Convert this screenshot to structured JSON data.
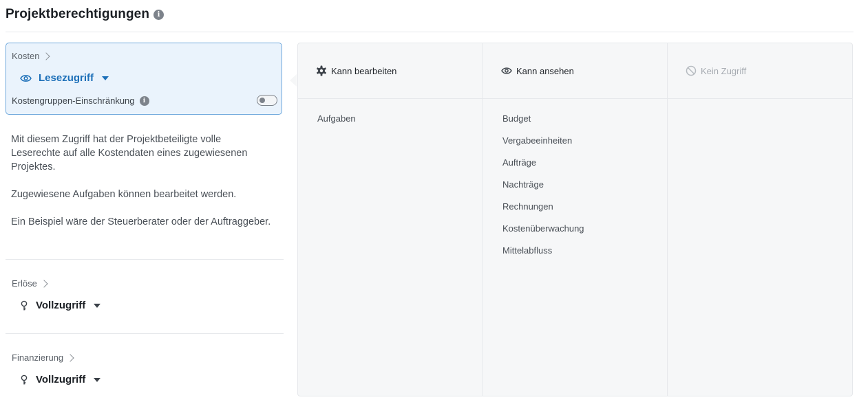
{
  "page": {
    "title": "Projektberechtigungen",
    "info_icon": "info-icon"
  },
  "cost_section": {
    "crumb": "Kosten",
    "access_level": "Lesezugriff",
    "access_icon": "eye-icon",
    "restriction_label": "Kostengruppen-Einschränkung",
    "restriction_enabled": false,
    "description": [
      "Mit diesem Zugriff hat der Projektbeteiligte volle Leserechte auf alle Kostendaten eines zugewiesenen Projektes.",
      "Zugewiesene Aufgaben können bearbeitet werden.",
      "Ein Beispiel wäre der Steuerberater oder der Auftraggeber."
    ]
  },
  "revenue_section": {
    "crumb": "Erlöse",
    "access_level": "Vollzugriff",
    "access_icon": "key-icon"
  },
  "financing_section": {
    "crumb": "Finanzierung",
    "access_level": "Vollzugriff",
    "access_icon": "key-icon"
  },
  "permissions": {
    "columns": [
      {
        "label": "Kann bearbeiten",
        "icon": "gear-icon",
        "items": [
          "Aufgaben"
        ]
      },
      {
        "label": "Kann ansehen",
        "icon": "eye-icon",
        "items": [
          "Budget",
          "Vergabeeinheiten",
          "Aufträge",
          "Nachträge",
          "Rechnungen",
          "Kostenüberwachung",
          "Mittelabfluss"
        ]
      },
      {
        "label": "Kein Zugriff",
        "icon": "no-access-icon",
        "items": []
      }
    ]
  },
  "colors": {
    "accent": "#1c6fb8",
    "active_card_bg": "#eaf3fc",
    "active_card_border": "#6fa8dc",
    "panel_bg": "#f6f7f8"
  }
}
